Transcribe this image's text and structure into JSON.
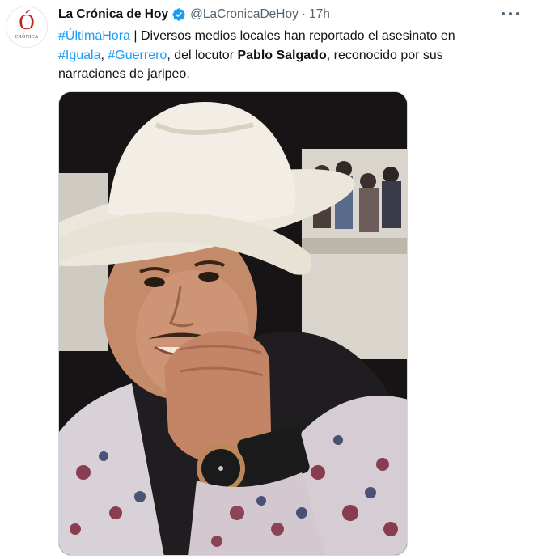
{
  "account": {
    "display_name": "La Crónica de Hoy",
    "handle": "@LaCronicaDeHoy",
    "separator": "·",
    "timestamp": "17h",
    "avatar_letter": "Ó",
    "avatar_label": "CRÓNICA",
    "verified_color": "#1d9bf0"
  },
  "tweet": {
    "line1_hashtag": "#ÚltimaHora",
    "line1_text": " | Diversos medios locales han reportado el asesinato en",
    "line2_hashtag1": "#Iguala",
    "line2_sep": ", ",
    "line2_hashtag2": "#Guerrero",
    "line2_text": ", del locutor ",
    "line2_bold": "Pablo Salgado",
    "line2_text_after": ", reconocido por sus",
    "line3_text": "narraciones de jaripeo."
  },
  "colors": {
    "link": "#1d9bf0",
    "muted": "#536471",
    "text": "#0f1419"
  },
  "icons": [
    "verified-badge-icon",
    "more-options-icon"
  ]
}
